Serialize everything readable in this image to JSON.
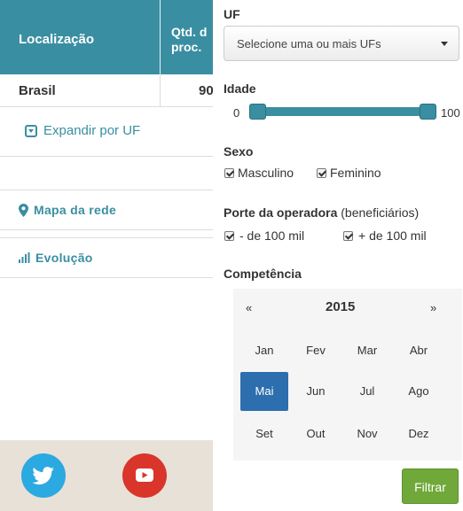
{
  "table": {
    "header_col1": "Localização",
    "header_col2": "Qtd. d\nproc.",
    "row_location": "Brasil",
    "row_value": "90"
  },
  "expand_label": "Expandir por UF",
  "nav": {
    "map_label": "Mapa da rede",
    "evolution_label": "Evolução"
  },
  "filters": {
    "uf_label": "UF",
    "uf_placeholder": "Selecione uma ou mais UFs",
    "age_label": "Idade",
    "age_min": "0",
    "age_max": "100",
    "sex_label": "Sexo",
    "sex_options": [
      "Masculino",
      "Feminino"
    ],
    "operator_label_bold": "Porte da operadora",
    "operator_label_normal": "(beneficiários)",
    "operator_options": [
      "- de 100 mil",
      "+ de 100 mil"
    ],
    "competence_label": "Competência",
    "calendar_prev": "«",
    "calendar_year": "2015",
    "calendar_next": "»",
    "months": [
      "Jan",
      "Fev",
      "Mar",
      "Abr",
      "Mai",
      "Jun",
      "Jul",
      "Ago",
      "Set",
      "Out",
      "Nov",
      "Dez"
    ],
    "selected_month": "Mai",
    "submit_label": "Filtrar"
  },
  "colors": {
    "accent": "#3a8ea2",
    "selected_month": "#2d6eae",
    "submit": "#70a83a",
    "twitter": "#2ba9e1",
    "youtube": "#d9352a"
  },
  "icons": [
    "chevron-down-square-icon",
    "map-marker-icon",
    "bar-chart-icon",
    "twitter-icon",
    "youtube-icon",
    "caret-down-icon"
  ]
}
